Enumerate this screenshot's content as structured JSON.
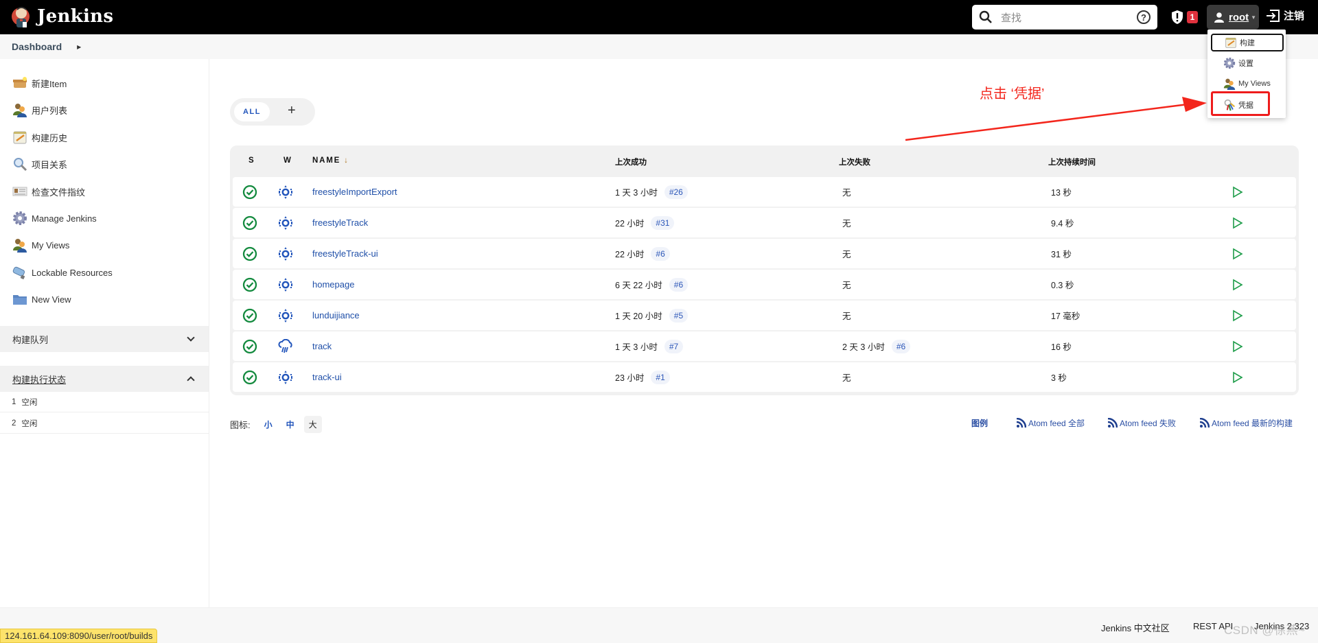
{
  "header": {
    "app_title": "Jenkins",
    "search_placeholder": "查找",
    "security_count": "1",
    "user": "root",
    "logout_label": "注销"
  },
  "breadcrumb": {
    "items": [
      "Dashboard"
    ]
  },
  "sidebar": {
    "items": [
      {
        "label": "新建Item",
        "icon": "new-item-icon"
      },
      {
        "label": "用户列表",
        "icon": "users-icon"
      },
      {
        "label": "构建历史",
        "icon": "build-history-icon"
      },
      {
        "label": "项目关系",
        "icon": "search-magnifier-icon"
      },
      {
        "label": "检查文件指纹",
        "icon": "fingerprint-icon"
      },
      {
        "label": "Manage Jenkins",
        "icon": "gear-icon"
      },
      {
        "label": "My Views",
        "icon": "users-icon"
      },
      {
        "label": "Lockable Resources",
        "icon": "usb-icon"
      },
      {
        "label": "New View",
        "icon": "folder-icon"
      }
    ],
    "build_queue": {
      "title": "构建队列",
      "expanded": false
    },
    "executor_status": {
      "title": "构建执行状态",
      "expanded": true,
      "executors": [
        {
          "num": "1",
          "state": "空闲"
        },
        {
          "num": "2",
          "state": "空闲"
        }
      ]
    }
  },
  "main": {
    "tabs": [
      {
        "label": "ALL",
        "active": true
      }
    ],
    "add_tab_label": "+",
    "table": {
      "headers": {
        "s": "S",
        "w": "W",
        "name": "NAME",
        "sort_indicator": "↓",
        "last_success": "上次成功",
        "last_failure": "上次失败",
        "last_duration": "上次持续时间"
      },
      "rows": [
        {
          "status": "success",
          "weather": "sunny",
          "name": "freestyleImportExport",
          "last_success": "1 天 3 小时",
          "success_build": "#26",
          "last_failure": "无",
          "failure_build": null,
          "duration": "13 秒"
        },
        {
          "status": "success",
          "weather": "sunny",
          "name": "freestyleTrack",
          "last_success": "22 小时",
          "success_build": "#31",
          "last_failure": "无",
          "failure_build": null,
          "duration": "9.4 秒"
        },
        {
          "status": "success",
          "weather": "sunny",
          "name": "freestyleTrack-ui",
          "last_success": "22 小时",
          "success_build": "#6",
          "last_failure": "无",
          "failure_build": null,
          "duration": "31 秒"
        },
        {
          "status": "success",
          "weather": "sunny",
          "name": "homepage",
          "last_success": "6 天 22 小时",
          "success_build": "#6",
          "last_failure": "无",
          "failure_build": null,
          "duration": "0.3 秒"
        },
        {
          "status": "success",
          "weather": "sunny",
          "name": "lunduijiance",
          "last_success": "1 天 20 小时",
          "success_build": "#5",
          "last_failure": "无",
          "failure_build": null,
          "duration": "17 毫秒"
        },
        {
          "status": "success",
          "weather": "rainy",
          "name": "track",
          "last_success": "1 天 3 小时",
          "success_build": "#7",
          "last_failure": "2 天 3 小时",
          "failure_build": "#6",
          "duration": "16 秒"
        },
        {
          "status": "success",
          "weather": "sunny",
          "name": "track-ui",
          "last_success": "23 小时",
          "success_build": "#1",
          "last_failure": "无",
          "failure_build": null,
          "duration": "3 秒"
        }
      ]
    },
    "icon_size": {
      "label": "图标:",
      "options": [
        "小",
        "中",
        "大"
      ],
      "selected": "大"
    },
    "legend_link": "图例",
    "feeds": [
      "Atom feed 全部",
      "Atom feed 失败",
      "Atom feed 最新的构建"
    ]
  },
  "user_menu": {
    "items": [
      {
        "label": "构建",
        "icon": "build-history-icon"
      },
      {
        "label": "设置",
        "icon": "gear-icon"
      },
      {
        "label": "My Views",
        "icon": "users-icon"
      },
      {
        "label": "凭据",
        "icon": "credentials-keys-icon"
      }
    ],
    "focused": "构建",
    "highlighted": "凭据"
  },
  "annotation": {
    "text": "点击 ‘凭据’",
    "color": "#f3261c"
  },
  "footer": {
    "community": "Jenkins 中文社区",
    "rest_api": "REST API",
    "version": "Jenkins 2.323"
  },
  "watermark": "CSDN @徐燕~",
  "status_url": "124.161.64.109:8090/user/root/builds",
  "colors": {
    "success": "#138a3e",
    "link": "#1f4fa8",
    "weather": "#2255bb",
    "badge": "#e0313d"
  }
}
